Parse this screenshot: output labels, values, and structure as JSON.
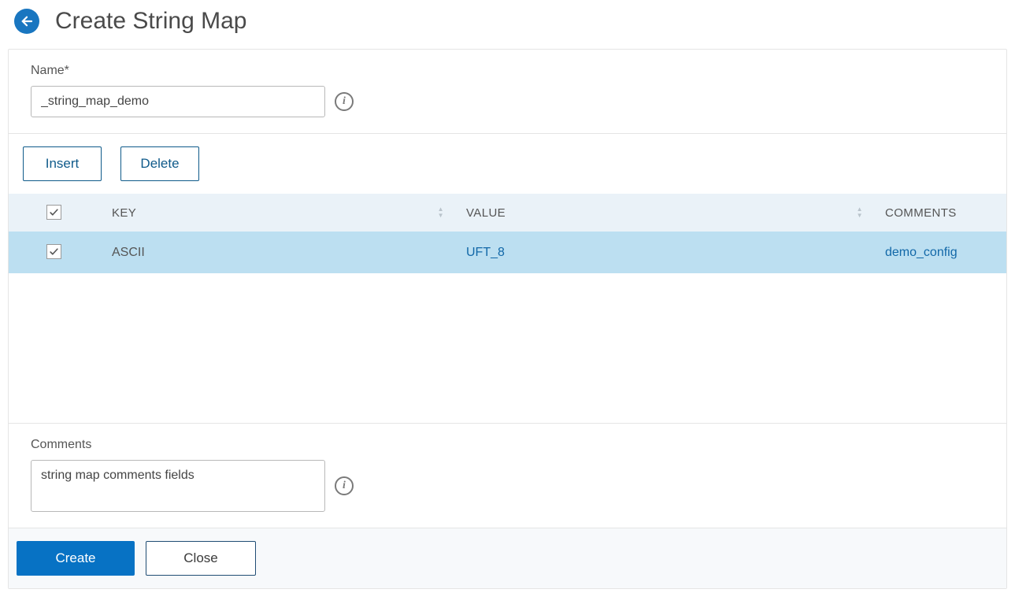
{
  "header": {
    "title": "Create String Map"
  },
  "form": {
    "name_label": "Name*",
    "name_value": "_string_map_demo",
    "comments_label": "Comments",
    "comments_value": "string map comments fields"
  },
  "toolbar": {
    "insert_label": "Insert",
    "delete_label": "Delete"
  },
  "table": {
    "columns": {
      "key": "KEY",
      "value": "VALUE",
      "comments": "COMMENTS"
    },
    "rows": [
      {
        "selected": true,
        "key": "ASCII",
        "value": "UFT_8",
        "comments": "demo_config"
      }
    ]
  },
  "footer": {
    "create_label": "Create",
    "close_label": "Close"
  },
  "icons": {
    "info": "i"
  }
}
